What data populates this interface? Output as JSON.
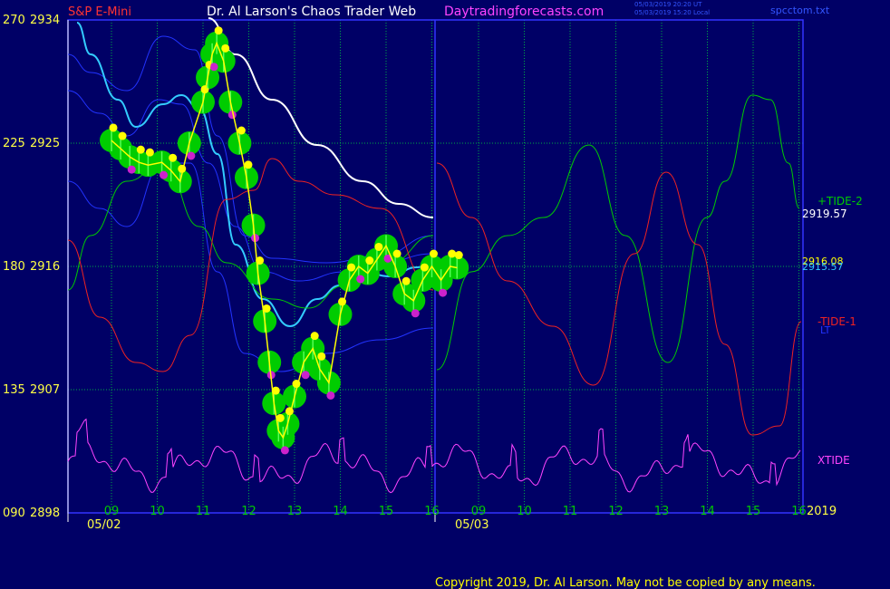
{
  "header": {
    "symbol": "S&P E-Mini",
    "title": "Dr. Al Larson's Chaos Trader Web",
    "website": "Daytradingforecasts.com",
    "timestamp_utc": "05/03/2019 20:20 UT",
    "timestamp_local": "05/03/2019 15:20 Local",
    "file": "spcctom.txt"
  },
  "footer": {
    "copyright": "Copyright 2019, Dr. Al Larson. May not be copied by any means."
  },
  "colors": {
    "background": "#000066",
    "frame": "#3333ff",
    "grid": "#00aa44",
    "white": "#ffffff",
    "green": "#00cc00",
    "yellow": "#ffff00",
    "cyan": "#33ccff",
    "blue": "#2233ff",
    "red": "#ee2222",
    "magenta": "#ff44ff",
    "date": "#ffff44"
  },
  "chart_data": {
    "type": "line",
    "y_labels_left": [
      {
        "angle": "270",
        "price": "2934"
      },
      {
        "angle": "225",
        "price": "2925"
      },
      {
        "angle": "180",
        "price": "2916"
      },
      {
        "angle": "135",
        "price": "2907"
      },
      {
        "angle": "090",
        "price": "2898"
      }
    ],
    "ylim": [
      2898,
      2934
    ],
    "x_ticks": [
      "09",
      "10",
      "11",
      "12",
      "13",
      "14",
      "15",
      "16",
      "09",
      "10",
      "11",
      "12",
      "13",
      "14",
      "15",
      "16"
    ],
    "date_labels": [
      "05/02",
      "05/03"
    ],
    "right_year": "2019",
    "right_labels": {
      "tide2": "+TIDE-2",
      "last_price": "2919.57",
      "price_a": "2916.08",
      "price_b": "2915.57",
      "tide1": "-TIDE-1",
      "lt": "LT",
      "xtide": "XTIDE"
    },
    "price_bars": [
      [
        0.0,
        2925.2
      ],
      [
        0.2,
        2924.6
      ],
      [
        0.4,
        2924.0
      ],
      [
        0.6,
        2923.6
      ],
      [
        0.8,
        2923.4
      ],
      [
        1.1,
        2923.6
      ],
      [
        1.3,
        2923.0
      ],
      [
        1.5,
        2922.2
      ],
      [
        1.7,
        2925.0
      ],
      [
        2.0,
        2928.0
      ],
      [
        2.1,
        2929.8
      ],
      [
        2.2,
        2931.5
      ],
      [
        2.3,
        2932.3
      ],
      [
        2.45,
        2931.0
      ],
      [
        2.6,
        2928.0
      ],
      [
        2.8,
        2925.0
      ],
      [
        2.95,
        2922.5
      ],
      [
        3.1,
        2919.0
      ],
      [
        3.2,
        2915.5
      ],
      [
        3.35,
        2912.0
      ],
      [
        3.45,
        2909.0
      ],
      [
        3.55,
        2906.0
      ],
      [
        3.65,
        2904.0
      ],
      [
        3.75,
        2903.5
      ],
      [
        3.85,
        2904.5
      ],
      [
        4.0,
        2906.5
      ],
      [
        4.2,
        2909.0
      ],
      [
        4.4,
        2910.0
      ],
      [
        4.55,
        2908.5
      ],
      [
        4.75,
        2907.5
      ],
      [
        5.0,
        2912.5
      ],
      [
        5.2,
        2915.0
      ],
      [
        5.4,
        2916.0
      ],
      [
        5.6,
        2915.5
      ],
      [
        5.8,
        2916.5
      ],
      [
        6.0,
        2917.5
      ],
      [
        6.2,
        2916.0
      ],
      [
        6.4,
        2914.0
      ],
      [
        6.6,
        2913.5
      ],
      [
        6.8,
        2915.0
      ],
      [
        7.0,
        2916.0
      ],
      [
        7.2,
        2915.0
      ],
      [
        7.4,
        2916.0
      ],
      [
        7.55,
        2915.9
      ]
    ],
    "series": [
      {
        "name": "+TIDE-2",
        "color_key": "green"
      },
      {
        "name": "-TIDE-1",
        "color_key": "red"
      },
      {
        "name": "XTIDE",
        "color_key": "magenta"
      }
    ]
  }
}
